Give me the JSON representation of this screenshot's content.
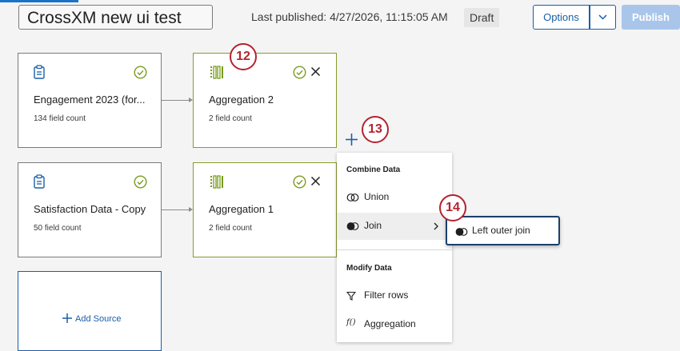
{
  "header": {
    "title": "CrossXM new ui test",
    "last_published": "Last published: 4/27/2026, 11:15:05 AM",
    "status": "Draft",
    "options_label": "Options",
    "publish_label": "Publish"
  },
  "sources": [
    {
      "name": "Engagement 2023 (for...",
      "count": "134 field count"
    },
    {
      "name": "Satisfaction Data - Copy",
      "count": "50 field count"
    }
  ],
  "aggregations": [
    {
      "name": "Aggregation 2",
      "count": "2 field count"
    },
    {
      "name": "Aggregation 1",
      "count": "2 field count"
    }
  ],
  "badges": [
    "12",
    "13",
    "14"
  ],
  "menu": {
    "combine_heading": "Combine Data",
    "union_label": "Union",
    "join_label": "Join",
    "modify_heading": "Modify Data",
    "filter_label": "Filter rows",
    "aggregation_label": "Aggregation"
  },
  "submenu": {
    "left_outer_join_label": "Left outer join"
  },
  "add_source_label": "Add Source",
  "colors": {
    "accent": "#1a5ea8",
    "agg_border": "#8a9a2a",
    "badge": "#b4232e",
    "check": "#7a9a1e"
  }
}
